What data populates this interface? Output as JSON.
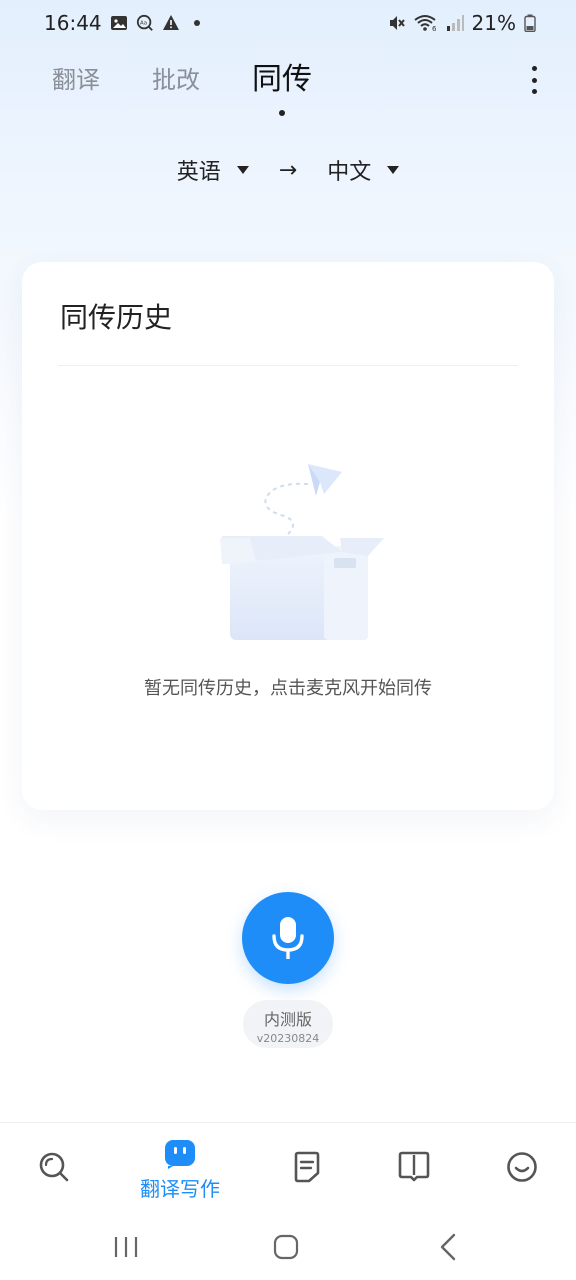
{
  "status_bar": {
    "time": "16:44",
    "battery": "21%",
    "icons_left": [
      "image-icon",
      "text-scan-icon",
      "warning-icon",
      "dot-icon"
    ],
    "icons_right": [
      "mute-icon",
      "wifi-icon",
      "signal-icon",
      "battery-icon"
    ]
  },
  "top_tabs": [
    {
      "label": "翻译",
      "active": false
    },
    {
      "label": "批改",
      "active": false
    },
    {
      "label": "同传",
      "active": true
    }
  ],
  "language": {
    "source": "英语",
    "target": "中文",
    "arrow": "→"
  },
  "history": {
    "title": "同传历史",
    "empty_text": "暂无同传历史，点击麦克风开始同传"
  },
  "mic": {
    "beta_label": "内测版",
    "version": "v20230824"
  },
  "bottom_nav": {
    "items": [
      {
        "icon": "search-icon",
        "label": ""
      },
      {
        "icon": "chat-bot-icon",
        "label": "翻译写作",
        "active": true
      },
      {
        "icon": "document-icon",
        "label": ""
      },
      {
        "icon": "book-icon",
        "label": ""
      },
      {
        "icon": "smile-icon",
        "label": ""
      }
    ]
  },
  "colors": {
    "accent": "#1e8df7",
    "gradient_top": "#e3effd",
    "text_primary": "#222222",
    "text_muted": "#8a8f99"
  }
}
